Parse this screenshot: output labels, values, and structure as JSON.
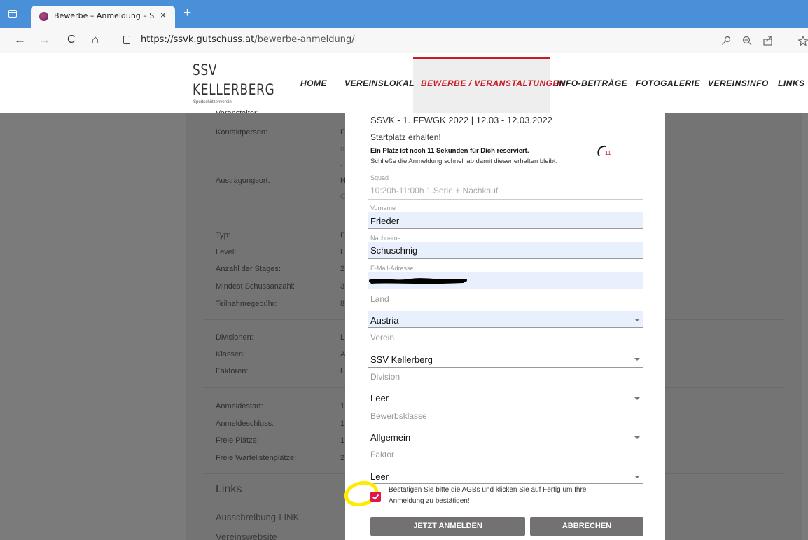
{
  "browser": {
    "tab_title": "Bewerbe – Anmeldung – SSV Kel",
    "tab_close": "×",
    "new_tab": "+",
    "url_host": "https://ssvk.gutschuss.at",
    "url_path": "/bewerbe-anmeldung/",
    "nav_back": "←",
    "nav_forward": "→",
    "nav_reload": "C",
    "nav_home": "⌂"
  },
  "site": {
    "logo_line1": "SSV",
    "logo_line2": "KELLERBERG",
    "logo_sub": "Sportschützenverein",
    "menu": [
      "HOME",
      "VEREINSLOKAL",
      "BEWERBE / VERANSTALTUNGEN",
      "INFO-BEITRÄGE",
      "FOTOGALERIE",
      "VEREINSINFO",
      "LINKS"
    ]
  },
  "background": {
    "rows": [
      "Veranstalter:",
      "Kontaktperson:",
      "Austragungsort:",
      "Typ:",
      "Level:",
      "Anzahl der Stages:",
      "Mindest Schussanzahl:",
      "Teilnahmegebühr:",
      "Divisionen:",
      "Klassen:",
      "Faktoren:",
      "Anmeldestart:",
      "Anmeldeschluss:",
      "Freie Plätze:",
      "Freie Wartelistenplätze:"
    ],
    "partial_values": [
      "F",
      "n",
      "-",
      "H",
      "C",
      "F",
      "L",
      "2",
      "3",
      "8",
      "L",
      "A",
      "L",
      "1",
      "1",
      "1",
      "2"
    ],
    "links_heading": "Links",
    "links": [
      "Ausschreibung-LINK",
      "Vereinswebsite"
    ]
  },
  "modal": {
    "event_title": "SSVK - 1. FFWGK 2022 | 12.03 - 12.03.2022",
    "start_heading": "Startplatz erhalten!",
    "reserved_text": "Ein Platz ist noch 11 Sekunden für Dich reserviert.",
    "hint_text": "Schließe die Anmeldung schnell ab damit dieser erhalten bleibt.",
    "countdown": "11",
    "squad_label": "Squad",
    "squad_value": "10:20h-11:00h  1.Serie + Nachkauf",
    "vorname_label": "Vorname",
    "vorname_value": "Frieder",
    "nachname_label": "Nachname",
    "nachname_value": "Schuschnig",
    "email_label": "E-Mail-Adresse",
    "land_label": "Land",
    "land_value": "Austria",
    "verein_label": "Verein",
    "verein_value": "SSV Kellerberg",
    "division_label": "Division",
    "division_value": "Leer",
    "klasse_label": "Bewerbsklasse",
    "klasse_value": "Allgemein",
    "faktor_label": "Faktor",
    "faktor_value": "Leer",
    "agb_text_1": "Bestätigen Sie bitte die AGBs und klicken Sie auf Fertig um Ihre",
    "agb_text_2": "Anmeldung zu bestätigen!",
    "submit_label": "JETZT ANMELDEN",
    "cancel_label": "ABBRECHEN"
  },
  "colors": {
    "accent": "#c81d25",
    "highlight": "#ffeb00",
    "tabbar": "#4a90d9"
  }
}
